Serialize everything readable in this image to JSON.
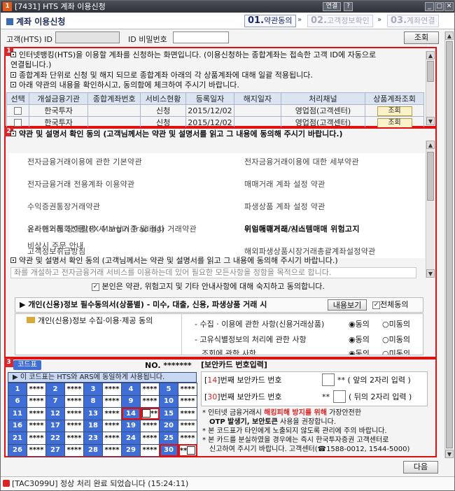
{
  "window": {
    "title": "[7431] HTS 계좌 이용신청",
    "tab_label": "계좌 이용신청",
    "buttons": {
      "link": "연결",
      "help": "?",
      "minimize": "_",
      "maximize": "□",
      "close": "✕"
    }
  },
  "steps": [
    {
      "num": "01.",
      "label": "약관동의"
    },
    {
      "num": "02.",
      "label": "고객정보확인"
    },
    {
      "num": "03.",
      "label": "계좌연결"
    }
  ],
  "login": {
    "id_label": "고객(HTS) ID",
    "pw_label": "ID 비밀번호",
    "query_button": "조회"
  },
  "section1": {
    "badge": "1",
    "lines": [
      "인터넷뱅킹(HTS)을 이용할 계좌를 신청하는 화면입니다. (이용신청하는 종합계좌는 접속한 고객 ID에 자동으로",
      "연결됩니다.)",
      "종합계좌 단위로 신청 및 해지 되므로 종합계좌 아래의 각 상품계좌에 대해 일괄 적용됩니다.",
      "아래 약관의 내용을 확인하시고, 동의함에 체크하여 주시기 바랍니다."
    ],
    "columns": [
      "선택",
      "개설금융기관",
      "종합계좌번호",
      "서비스현황",
      "등록일자",
      "해지일자",
      "처리채널",
      "상품계좌조회"
    ],
    "rows": [
      {
        "institution": "한국투자",
        "account": "",
        "status": "신청",
        "reg_date": "2015/12/02",
        "cancel_date": "",
        "channel": "영업점(고객센터)",
        "lookup": "조회"
      },
      {
        "institution": "한국투자",
        "account": "",
        "status": "신청",
        "reg_date": "2015/12/02",
        "cancel_date": "",
        "channel": "영업점(고객센터)",
        "lookup": "조회"
      }
    ]
  },
  "section2": {
    "badge": "2",
    "header": "약관 및 설명서 확인 동의 (고객님께서는 약관 및 설명서를 읽고 그 내용에 동의해 주시기 바랍니다.)",
    "terms_left": [
      "전자금융거래이용에 관한 기본약관",
      "전자금융거래 전용계좌 이용약관",
      "수익증권통장거래약관",
      "유사해외통화선물(FX Margin Trading) 거래약관",
      "고객정보취급방침",
      "온라인거래 장애발생 시 보상기준 및 절차",
      "비상시 주문 안내"
    ],
    "terms_right": [
      "전자금융거래이용에 대한 세부약관",
      "매매거래 계좌 설정 약관",
      "파생상품 계좌 설정 약관",
      "미수동결제도 안내",
      "해외파생상품시장거래총괄계좌설정약관",
      "위임매매거래/시스템매매 위험고지"
    ],
    "terms_right_bold": "위임매매거래/시스템매매 위험고지",
    "header2": "약관 및 설명서 확인 동의 (고객님께서는 약관 및 설명서를 읽고 그 내용에 동의해 주시기 바랍니다.)",
    "preview": "좌를 개설하고 전자금융거래 서비스를 이용하는데 있어 필요한 모든사항을 정함을 목적으로 합니다.",
    "agree_text": "본인은 약관, 위험고지 및 기타 안내사항에 대해 숙지하고 동의합니다.",
    "privacy_title": "▶ 개인(신용)정보 필수동의서(상품별) - 미수, 대출, 신용, 파생상품 거래 시",
    "privacy_view_button": "내용보기",
    "privacy_all_agree": "전체동의",
    "privacy_item": "개인(신용)정보 수집·이용·제공 동의",
    "privacy_rows": [
      {
        "label": "- 수집 · 이용에 관한 사항(신용거래상품)",
        "agree": "동의",
        "disagree": "미동의"
      },
      {
        "label": "- 고유식별정보의 처리에 관한 사항",
        "agree": "동의",
        "disagree": "미동의"
      },
      {
        "label": "조회에 관한 사항",
        "agree": "동의",
        "disagree": "미동의"
      }
    ]
  },
  "section3": {
    "badge": "3",
    "code_tab": "코드표",
    "no_label": "NO. *******",
    "code_header": "▶ 이 코드표는 HTS와 ARS에 동일하게 사용됩니다.",
    "codes": [
      [
        1,
        2,
        3,
        4,
        5
      ],
      [
        6,
        7,
        8,
        9,
        10
      ],
      [
        11,
        12,
        13,
        14,
        15
      ],
      [
        16,
        17,
        18,
        19,
        20
      ],
      [
        21,
        22,
        23,
        24,
        25
      ],
      [
        26,
        27,
        28,
        29,
        30
      ]
    ],
    "masked": "****",
    "input_title": "[보안카드 번호입력]",
    "first_label": "번째 보안카드 번호",
    "first_num": "14",
    "first_hint": "** ( 앞의 2자리 입력 )",
    "second_label": "번째 보안카드 번호",
    "second_num": "30",
    "second_hint": "( 뒤의 2자리 입력 )",
    "second_prefix": "**",
    "notes": [
      [
        "* 인터넷 금융거래시 ",
        "해킹피해 방지를 위해",
        " 가장안전한"
      ],
      [
        "OTP 발생기, 보안토큰",
        " 사용을 권장합니다."
      ],
      [
        "* 본 코드표가 타인에게 노출되지 않도록 관리에 주의 바랍니다."
      ],
      [
        "* 본 카드를 분실하였을 경우에는 즉시 한국투자증권 고객센터로"
      ],
      [
        "신고하여 주시기 바랍니다. 고객센터(☎1588-0012, 1544-5000)"
      ]
    ]
  },
  "next_button": "다음",
  "status": {
    "text": "[TAC3099U] 정상 처리 완료 되었습니다 (15:24:11)"
  },
  "colors": {
    "accent_red": "#e01010",
    "code_blue": "#3f6fd6",
    "title_bg": "#2e3239"
  }
}
